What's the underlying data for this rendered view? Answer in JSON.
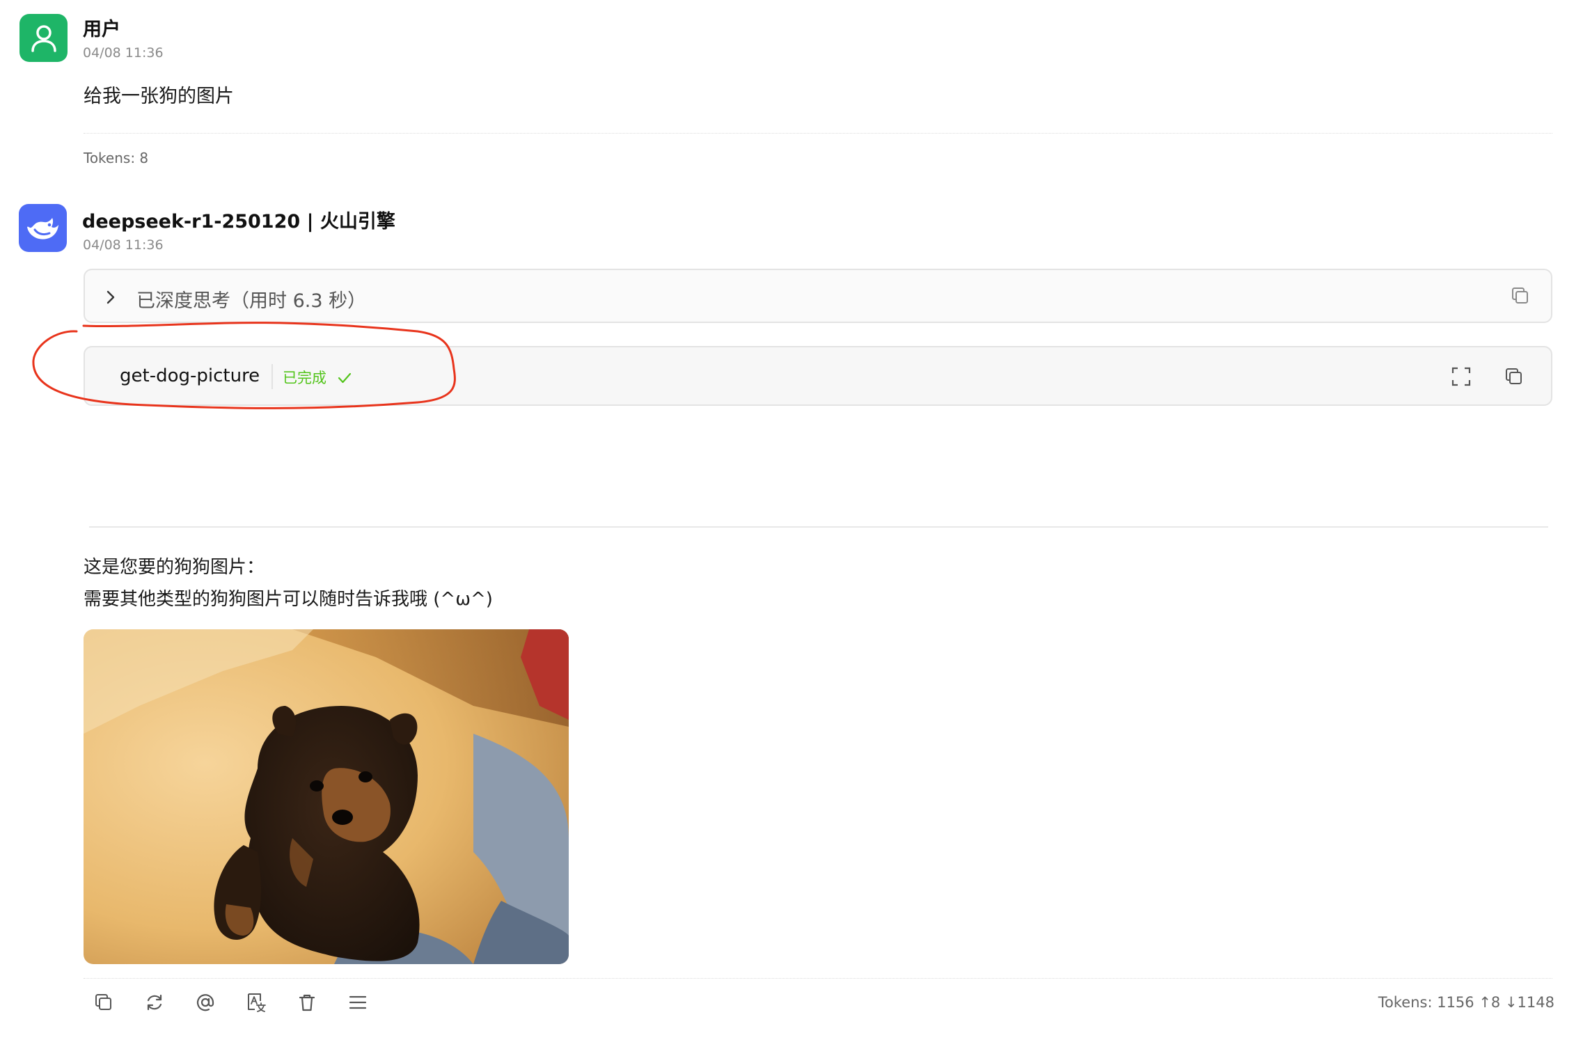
{
  "user_message": {
    "avatar_icon": "user-icon",
    "name": "用户",
    "time": "04/08 11:36",
    "text": "给我一张狗的图片",
    "tokens": "Tokens: 8"
  },
  "assistant_message": {
    "avatar_icon": "deepseek-whale-icon",
    "name": "deepseek-r1-250120 | 火山引擎",
    "time": "04/08 11:36",
    "thinking": {
      "label": "已深度思考（用时 6.3 秒）"
    },
    "tool_call": {
      "name": "get-dog-picture",
      "status": "已完成"
    },
    "reply_line1": "这是您要的狗狗图片：",
    "reply_line2": "需要其他类型的狗狗图片可以随时告诉我哦 (^ω^)",
    "image_alt": "puppy photo",
    "tokens": "Tokens: 1156 ↑8 ↓1148"
  },
  "colors": {
    "user_avatar": "#1eb567",
    "bot_avatar": "#4e6bf5",
    "status_green": "#52c41a",
    "annotation_red": "#e8341c"
  },
  "toolbar_icons": [
    "copy-icon",
    "regenerate-icon",
    "mention-icon",
    "translate-icon",
    "delete-icon",
    "menu-icon"
  ]
}
